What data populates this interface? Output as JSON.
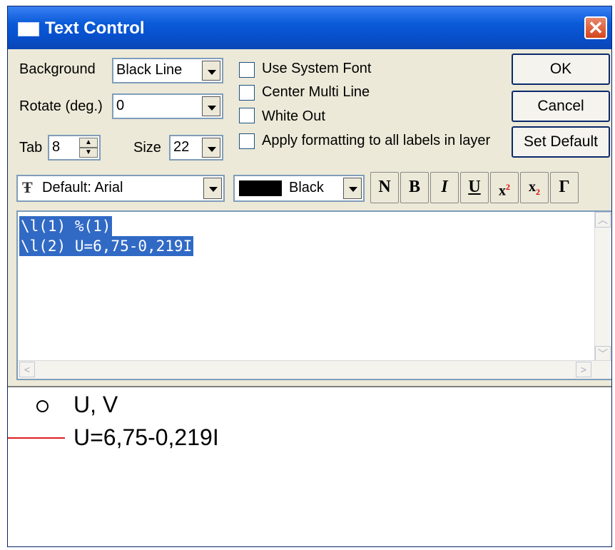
{
  "window": {
    "title": "Text Control"
  },
  "background": {
    "label": "Background",
    "value": "Black Line"
  },
  "rotate": {
    "label": "Rotate (deg.)",
    "value": "0"
  },
  "tab": {
    "label": "Tab",
    "value": "8"
  },
  "size": {
    "label": "Size",
    "value": "22"
  },
  "options": {
    "use_system_font": "Use System Font",
    "center_multi_line": "Center Multi Line",
    "white_out": "White Out",
    "apply_formatting": "Apply formatting to all labels in layer"
  },
  "buttons": {
    "ok": "OK",
    "cancel": "Cancel",
    "set_default": "Set Default"
  },
  "font": {
    "value": "Default: Arial",
    "icon": "font-tt-icon"
  },
  "color": {
    "name": "Black",
    "swatch": "#000000"
  },
  "format_buttons": {
    "normal": "N",
    "bold": "B",
    "italic": "I",
    "underline": "U",
    "superscript_base": "x",
    "superscript_exp": "2",
    "subscript_base": "x",
    "subscript_exp": "2",
    "greek": "Γ"
  },
  "editor": {
    "lines": [
      "\\l(1) %(1)",
      "\\l(2) U=6,75-0,219I"
    ]
  },
  "preview": {
    "entries": [
      {
        "symbol": "open-circle",
        "text": "U, V"
      },
      {
        "symbol": "red-line",
        "color": "#e02020",
        "text": "U=6,75-0,219I"
      }
    ]
  }
}
